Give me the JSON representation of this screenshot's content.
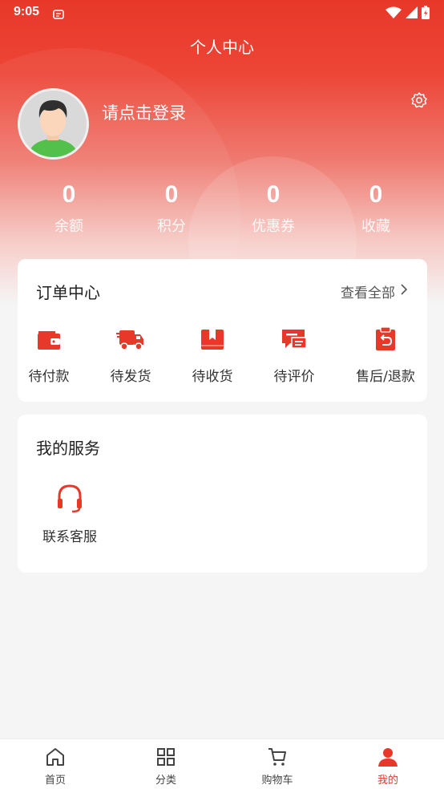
{
  "status_bar": {
    "time": "9:05"
  },
  "header": {
    "title": "个人中心"
  },
  "profile": {
    "login_text": "请点击登录"
  },
  "stats": [
    {
      "value": "0",
      "label": "余额"
    },
    {
      "value": "0",
      "label": "积分"
    },
    {
      "value": "0",
      "label": "优惠券"
    },
    {
      "value": "0",
      "label": "收藏"
    }
  ],
  "orders": {
    "title": "订单中心",
    "view_all": "查看全部",
    "items": [
      {
        "label": "待付款",
        "icon": "wallet-icon"
      },
      {
        "label": "待发货",
        "icon": "truck-icon"
      },
      {
        "label": "待收货",
        "icon": "box-icon"
      },
      {
        "label": "待评价",
        "icon": "comment-icon"
      },
      {
        "label": "售后/退款",
        "icon": "return-icon"
      }
    ]
  },
  "services": {
    "title": "我的服务",
    "items": [
      {
        "label": "联系客服",
        "icon": "headset-icon"
      }
    ]
  },
  "tabbar": {
    "items": [
      {
        "label": "首页",
        "icon": "home-icon"
      },
      {
        "label": "分类",
        "icon": "grid-icon"
      },
      {
        "label": "购物车",
        "icon": "cart-icon"
      },
      {
        "label": "我的",
        "icon": "user-icon",
        "active": true
      }
    ]
  },
  "colors": {
    "accent": "#e8382a"
  }
}
